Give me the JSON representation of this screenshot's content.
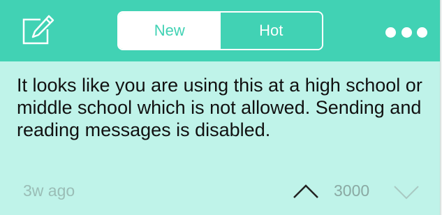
{
  "header": {
    "tabs": [
      {
        "label": "New",
        "selected": true
      },
      {
        "label": "Hot",
        "selected": false
      }
    ],
    "compose_icon": "compose-icon",
    "more_icon": "more-dots-icon"
  },
  "post": {
    "message": "It looks like you are using this at a high school or middle school which is not allowed. Sending and reading messages is disabled.",
    "time": "3w ago",
    "score": "3000"
  },
  "colors": {
    "accent": "#41d2b4",
    "card_background": "#bff3e9",
    "text": "#111111",
    "muted_text": "#9abdb6"
  }
}
